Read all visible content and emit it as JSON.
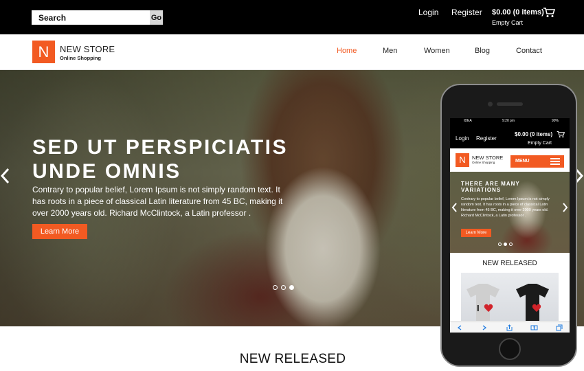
{
  "topbar": {
    "search_placeholder": "Search",
    "go_label": "Go",
    "login": "Login",
    "register": "Register",
    "cart_total": "$0.00 (0 items)",
    "cart_status": "Empty Cart"
  },
  "header": {
    "logo_letter": "N",
    "logo_title": "NEW STORE",
    "logo_subtitle": "Online Shopping",
    "nav": [
      "Home",
      "Men",
      "Women",
      "Blog",
      "Contact"
    ]
  },
  "hero": {
    "title": "SED UT PERSPICIATIS UNDE OMNIS",
    "text": "Contrary to popular belief, Lorem Ipsum is not simply random text. It has roots in a piece of classical Latin literature from 45 BC, making it over 2000 years old. Richard McClintock, a Latin professor .",
    "button": "Learn More",
    "slides_count": 3,
    "active_slide": 3
  },
  "section": {
    "title": "NEW RELEASED"
  },
  "phone": {
    "status_carrier": "IDEA",
    "status_time": "9:20 pm",
    "status_battery": "90%",
    "login": "Login",
    "register": "Register",
    "cart_total": "$0.00 (0 items)",
    "cart_status": "Empty Cart",
    "logo_letter": "N",
    "logo_title": "NEW STORE",
    "logo_subtitle": "Online Shopping",
    "menu": "MENU",
    "hero_title": "THERE ARE MANY VARIATIONS",
    "hero_text": "Contrary to popular belief, Lorem Ipsum is not simply random text. It has roots in a piece of classical Latin literature from 45 BC, making it over 2000 years old. Richard McClintock, a Latin professor .",
    "hero_button": "Learn More",
    "section_title": "NEW RELEASED",
    "product_text": "I"
  },
  "colors": {
    "accent": "#f25a22",
    "topbar": "#000000"
  }
}
